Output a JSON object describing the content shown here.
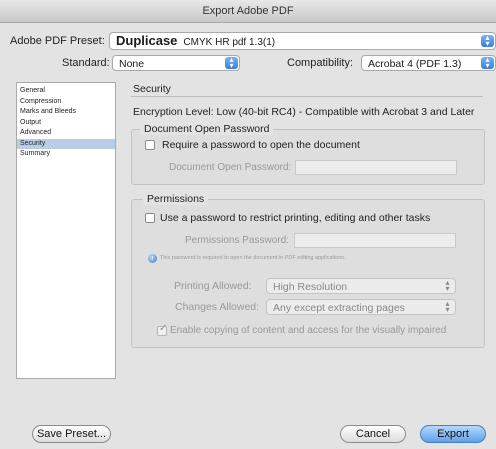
{
  "window": {
    "title": "Export Adobe PDF"
  },
  "preset": {
    "label": "Adobe PDF Preset:",
    "name": "Duplicase",
    "detail": "CMYK HR pdf 1.3(1)"
  },
  "standard": {
    "label": "Standard:",
    "value": "None"
  },
  "compatibility": {
    "label": "Compatibility:",
    "value": "Acrobat 4 (PDF 1.3)"
  },
  "sidebar": {
    "items": [
      {
        "label": "General"
      },
      {
        "label": "Compression"
      },
      {
        "label": "Marks and Bleeds"
      },
      {
        "label": "Output"
      },
      {
        "label": "Advanced"
      },
      {
        "label": "Security"
      },
      {
        "label": "Summary"
      }
    ],
    "selected_index": 5
  },
  "security": {
    "title": "Security",
    "encryption": "Encryption Level: Low (40-bit RC4) - Compatible with Acrobat 3 and Later",
    "open_password_group": {
      "title": "Document Open Password",
      "require_checkbox_label": "Require a password to open the document",
      "field_label": "Document Open Password:"
    },
    "permissions_group": {
      "title": "Permissions",
      "restrict_checkbox_label": "Use a password to restrict printing, editing and other tasks",
      "field_label": "Permissions Password:",
      "note": "This password is required to open the document in PDF editing applications.",
      "printing_label": "Printing Allowed:",
      "printing_value": "High Resolution",
      "changes_label": "Changes Allowed:",
      "changes_value": "Any except extracting pages",
      "copy_checkbox_label": "Enable copying of content and access for the visually impaired"
    }
  },
  "buttons": {
    "save_preset": "Save Preset...",
    "cancel": "Cancel",
    "export": "Export"
  }
}
